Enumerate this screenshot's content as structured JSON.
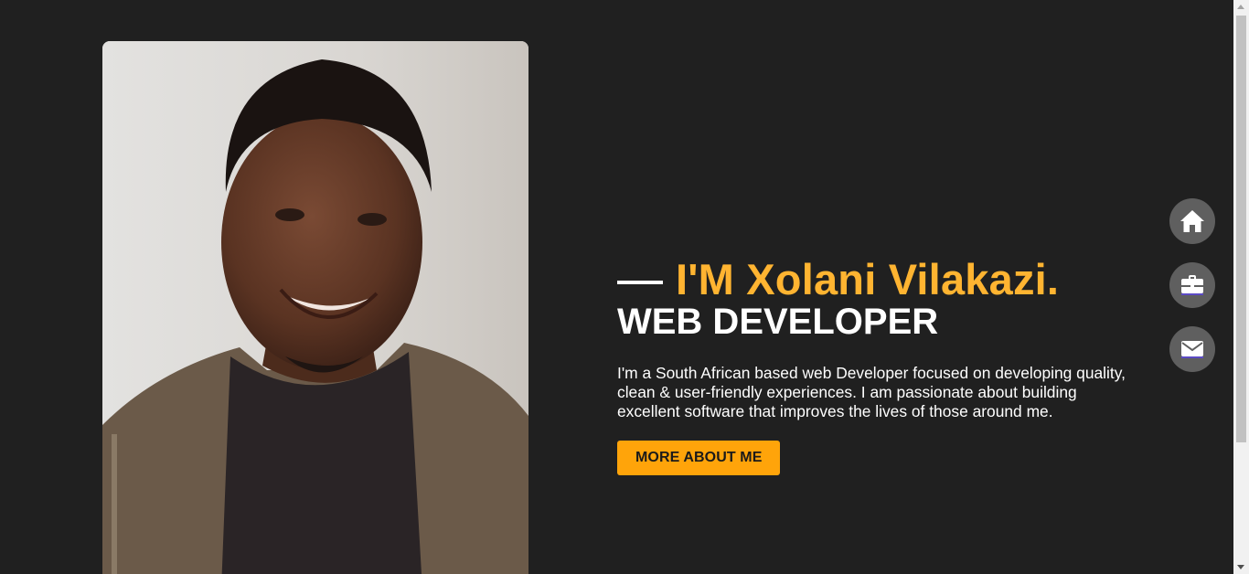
{
  "hero": {
    "name": "I'M Xolani Vilakazi.",
    "role": "WEB DEVELOPER",
    "bio": "I'm a South African based web Developer focused on developing quality, clean & user-friendly experiences. I am passionate about building excellent software that improves the lives of those around me.",
    "cta_label": "MORE ABOUT ME"
  },
  "side_nav": {
    "items": [
      {
        "icon": "home-icon"
      },
      {
        "icon": "briefcase-icon"
      },
      {
        "icon": "envelope-icon"
      }
    ]
  },
  "colors": {
    "background": "#202020",
    "accent": "#ffb431",
    "button": "#ffa40a",
    "nav_button": "#5f5f5f"
  }
}
